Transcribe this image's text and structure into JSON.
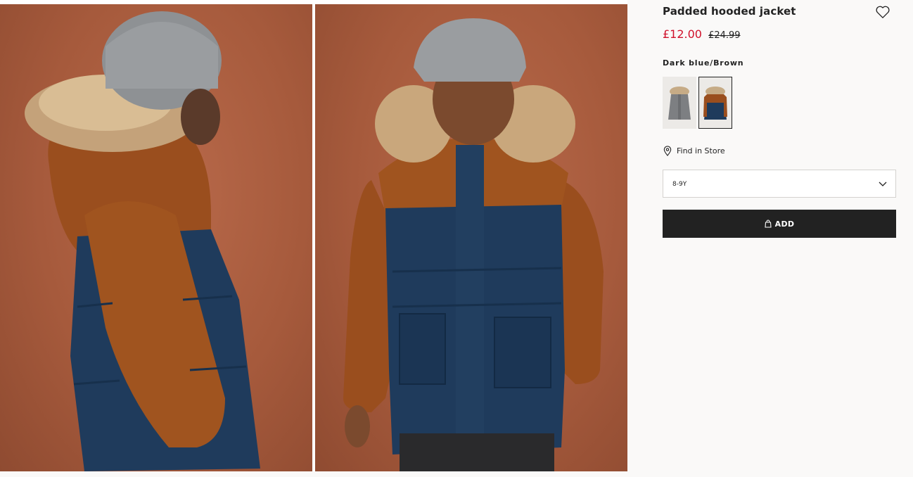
{
  "product": {
    "title": "Padded hooded jacket",
    "price_sale": "£12.00",
    "price_original": "£24.99",
    "color_name": "Dark blue/Brown",
    "find_in_store_label": "Find in Store",
    "size_selected": "8-9Y",
    "add_button_label": "ADD"
  },
  "colors": {
    "sale_price": "#d0112b",
    "add_button_bg": "#222222",
    "photo_background": "#a65a3c",
    "jacket_brown": "#9a4e1e",
    "jacket_navy": "#1f3b5c"
  },
  "icons": {
    "wishlist": "heart-icon",
    "find_in_store": "location-pin-icon",
    "size_dropdown": "chevron-down-icon",
    "add_to_bag": "shopping-bag-icon"
  },
  "swatches": [
    {
      "color": "grey",
      "selected": false
    },
    {
      "color": "dark-blue-brown",
      "selected": true
    }
  ]
}
